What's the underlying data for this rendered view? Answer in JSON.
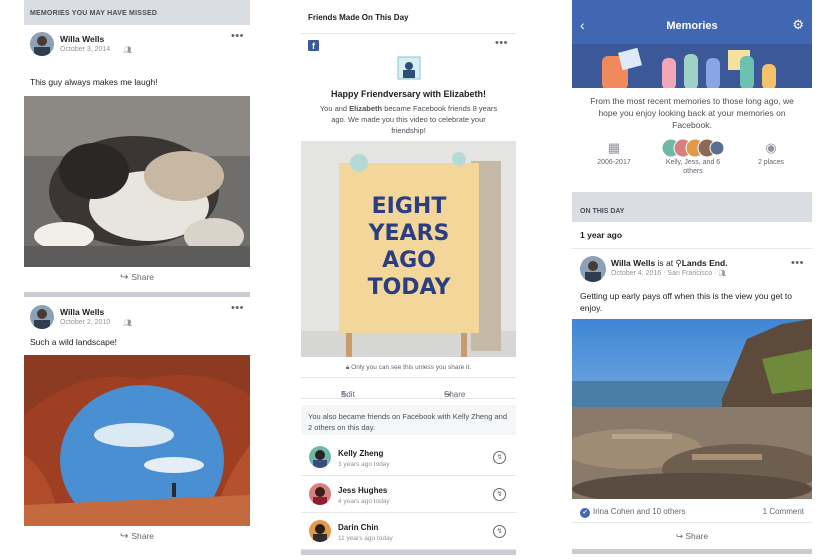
{
  "panel1": {
    "section_header": "MEMORIES YOU MAY HAVE MISSED",
    "posts": [
      {
        "name": "Willa Wells",
        "date": "October 3, 2014",
        "audience": "friends-icon",
        "caption": "This guy always makes me laugh!",
        "share_label": "Share"
      },
      {
        "name": "Willa Wells",
        "date": "October 2, 2010",
        "audience": "friends-icon",
        "caption": "Such a wild landscape!",
        "share_label": "Share"
      }
    ],
    "more_glyph": "•••"
  },
  "panel2": {
    "header": "Friends Made On This Day",
    "logo_letter": "f",
    "title": "Happy Friendversary with Elizabeth!",
    "body_prefix": "You and ",
    "body_name": "Elizabeth",
    "body_suffix": " became Facebook friends 8 years ago. We made you this video to celebrate your friendship!",
    "card_lines": [
      "EIGHT",
      "YEARS",
      "AGO",
      "TODAY"
    ],
    "privacy_note": "Only you can see this unless you share it.",
    "edit_label": "Edit",
    "share_label": "Share",
    "friends_intro": "You also became friends on Facebook with Kelly Zheng and 2 others on this day.",
    "friends": [
      {
        "name": "Kelly Zheng",
        "since": "3 years ago today"
      },
      {
        "name": "Jess Hughes",
        "since": "4 years ago today"
      },
      {
        "name": "Darin Chin",
        "since": "11 years ago today"
      }
    ]
  },
  "panel3": {
    "nav_title": "Memories",
    "intro": "From the most recent memories to those long ago, we hope you enjoy looking back at your memories on Facebook.",
    "stats": [
      {
        "icon": "calendar-icon",
        "label": "2006-2017"
      },
      {
        "icon": "friends-avatars",
        "label": "Kelly, Jess, and 6 others"
      },
      {
        "icon": "location-pin-icon",
        "label": "2 places"
      }
    ],
    "section": "ON THIS DAY",
    "year_label": "1 year ago",
    "post": {
      "name": "Willa Wells",
      "is_at": " is at ",
      "place": "Lands End.",
      "date": "October 4, 2016 · San Francisco ·",
      "text": "Getting up early pays off when this is the view you get to enjoy.",
      "reactions": "Irina Cohen and 10 others",
      "comments": "1 Comment",
      "share_label": "Share"
    }
  },
  "colors": {
    "facebook_blue": "#4267b2",
    "banner_blue": "#3b5998",
    "section_gray": "#dadde1"
  }
}
